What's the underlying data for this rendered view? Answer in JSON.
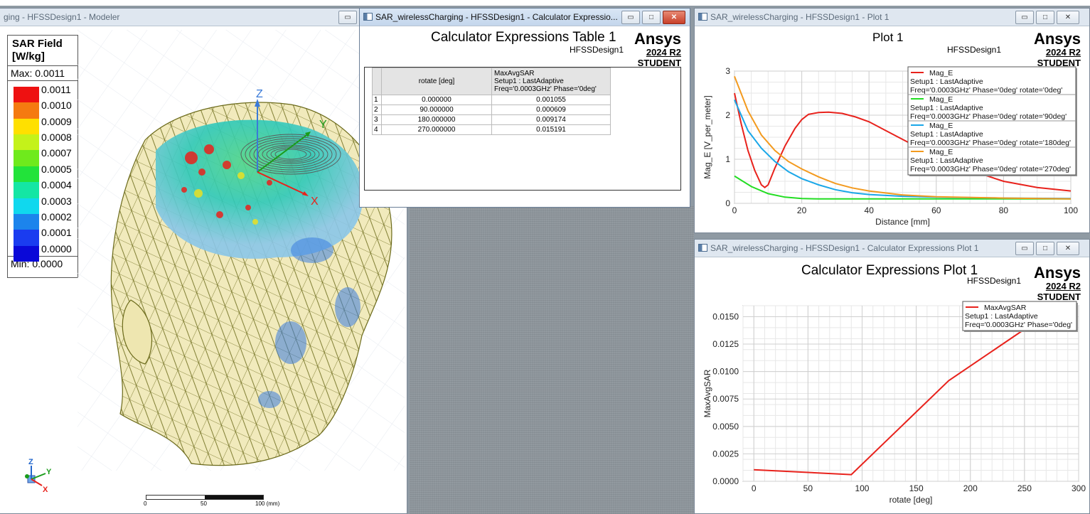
{
  "colors": {
    "chart_red": "#e8221c",
    "chart_green": "#22dd22",
    "chart_cyan": "#1aa7e8",
    "chart_orange": "#f39a1e",
    "titlebar_active": "#c4d6ec",
    "titlebar_inactive": "#dfe7f0"
  },
  "brand": {
    "name": "Ansys",
    "version": "2024 R2",
    "edition": "STUDENT"
  },
  "modeler": {
    "title": "ging - HFSSDesign1 - Modeler",
    "brand_partial": "A",
    "legend": {
      "title_line1": "SAR Field",
      "title_line2": "[W/kg]",
      "max_label": "Max: 0.0011",
      "min_label": "Min: 0.0000",
      "levels": [
        {
          "label": "0.0011",
          "color": "#ee1111"
        },
        {
          "label": "0.0010",
          "color": "#f57a10"
        },
        {
          "label": "0.0009",
          "color": "#ffe000"
        },
        {
          "label": "0.0008",
          "color": "#c4f21a"
        },
        {
          "label": "0.0007",
          "color": "#6fea1c"
        },
        {
          "label": "0.0005",
          "color": "#22e33a"
        },
        {
          "label": "0.0004",
          "color": "#14e6a4"
        },
        {
          "label": "0.0003",
          "color": "#10d8ee"
        },
        {
          "label": "0.0002",
          "color": "#1c84ec"
        },
        {
          "label": "0.0001",
          "color": "#1a3cf0"
        },
        {
          "label": "0.0000",
          "color": "#0a08d8"
        }
      ]
    },
    "axes": {
      "x": "X",
      "y": "Y",
      "z": "Z"
    },
    "scale": {
      "t0": "0",
      "t1": "50",
      "t2": "100 (mm)"
    }
  },
  "calc_table": {
    "title": "SAR_wirelessCharging - HFSSDesign1 - Calculator Expressio...",
    "heading": "Calculator Expressions Table 1",
    "design": "HFSSDesign1",
    "columns": [
      "rotate [deg]",
      "MaxAvgSAR",
      "Setup1 : LastAdaptive",
      "Freq='0.0003GHz' Phase='0deg'"
    ],
    "rows": [
      {
        "idx": "1",
        "rotate": "0.000000",
        "sar": "0.001055"
      },
      {
        "idx": "2",
        "rotate": "90.000000",
        "sar": "0.000609"
      },
      {
        "idx": "3",
        "rotate": "180.000000",
        "sar": "0.009174"
      },
      {
        "idx": "4",
        "rotate": "270.000000",
        "sar": "0.015191"
      }
    ]
  },
  "plot1": {
    "title": "SAR_wirelessCharging - HFSSDesign1 - Plot 1",
    "heading": "Plot 1",
    "design": "HFSSDesign1"
  },
  "plot2": {
    "title": "SAR_wirelessCharging - HFSSDesign1 - Calculator Expressions Plot 1",
    "heading": "Calculator Expressions Plot 1",
    "design": "HFSSDesign1"
  },
  "chart_data": [
    {
      "type": "line",
      "title": "Plot 1",
      "xlabel": "Distance [mm]",
      "ylabel": "Mag_E [V_per_meter]",
      "xlim": [
        0,
        100
      ],
      "ylim": [
        0,
        3
      ],
      "xticks": [
        "0",
        "20",
        "40",
        "60",
        "80",
        "100"
      ],
      "yticks": [
        "0",
        "1",
        "2",
        "3"
      ],
      "grid": true,
      "legend_position": "top-right",
      "series": [
        {
          "name": "Mag_E",
          "setup": "Setup1 : LastAdaptive",
          "desc": "Freq='0.0003GHz' Phase='0deg' rotate='0deg'",
          "color": "#e8221c",
          "x": [
            0,
            2,
            4,
            6,
            8,
            9,
            10,
            12,
            15,
            18,
            20,
            22,
            25,
            28,
            32,
            36,
            40,
            45,
            50,
            55,
            60,
            70,
            80,
            90,
            100
          ],
          "y": [
            2.5,
            1.8,
            1.2,
            0.75,
            0.42,
            0.36,
            0.42,
            0.8,
            1.3,
            1.7,
            1.9,
            2.02,
            2.06,
            2.07,
            2.04,
            1.96,
            1.85,
            1.65,
            1.45,
            1.25,
            1.05,
            0.75,
            0.5,
            0.36,
            0.28
          ]
        },
        {
          "name": "Mag_E",
          "setup": "Setup1 : LastAdaptive",
          "desc": "Freq='0.0003GHz' Phase='0deg' rotate='90deg'",
          "color": "#22dd22",
          "x": [
            0,
            5,
            10,
            15,
            20,
            25,
            30,
            40,
            50,
            60,
            80,
            100
          ],
          "y": [
            0.62,
            0.38,
            0.22,
            0.14,
            0.11,
            0.1,
            0.1,
            0.1,
            0.1,
            0.1,
            0.1,
            0.1
          ]
        },
        {
          "name": "Mag_E",
          "setup": "Setup1 : LastAdaptive",
          "desc": "Freq='0.0003GHz' Phase='0deg' rotate='180deg'",
          "color": "#1aa7e8",
          "x": [
            0,
            4,
            8,
            12,
            16,
            20,
            25,
            30,
            35,
            40,
            50,
            60,
            80,
            100
          ],
          "y": [
            2.35,
            1.65,
            1.25,
            0.95,
            0.72,
            0.56,
            0.42,
            0.31,
            0.24,
            0.2,
            0.16,
            0.14,
            0.12,
            0.11
          ]
        },
        {
          "name": "Mag_E",
          "setup": "Setup1 : LastAdaptive",
          "desc": "Freq='0.0003GHz' Phase='0deg' rotate='270deg'",
          "color": "#f39a1e",
          "x": [
            0,
            4,
            8,
            12,
            16,
            20,
            25,
            30,
            35,
            40,
            50,
            60,
            80,
            100
          ],
          "y": [
            2.88,
            2.1,
            1.55,
            1.2,
            0.95,
            0.78,
            0.6,
            0.45,
            0.35,
            0.28,
            0.19,
            0.15,
            0.12,
            0.1
          ]
        }
      ]
    },
    {
      "type": "line",
      "title": "Calculator Expressions Plot 1",
      "xlabel": "rotate [deg]",
      "ylabel": "MaxAvgSAR",
      "xlim": [
        -10,
        300
      ],
      "ylim": [
        0,
        0.016
      ],
      "xticks": [
        "0",
        "50",
        "100",
        "150",
        "200",
        "250",
        "300"
      ],
      "yticks": [
        "0.0000",
        "0.0025",
        "0.0050",
        "0.0075",
        "0.0100",
        "0.0125",
        "0.0150"
      ],
      "grid": true,
      "legend_position": "top-right",
      "series": [
        {
          "name": "MaxAvgSAR",
          "setup": "Setup1 : LastAdaptive",
          "desc": "Freq='0.0003GHz' Phase='0deg'",
          "color": "#e8221c",
          "x": [
            0,
            90,
            180,
            270
          ],
          "y": [
            0.001055,
            0.000609,
            0.009174,
            0.015191
          ]
        }
      ]
    }
  ]
}
